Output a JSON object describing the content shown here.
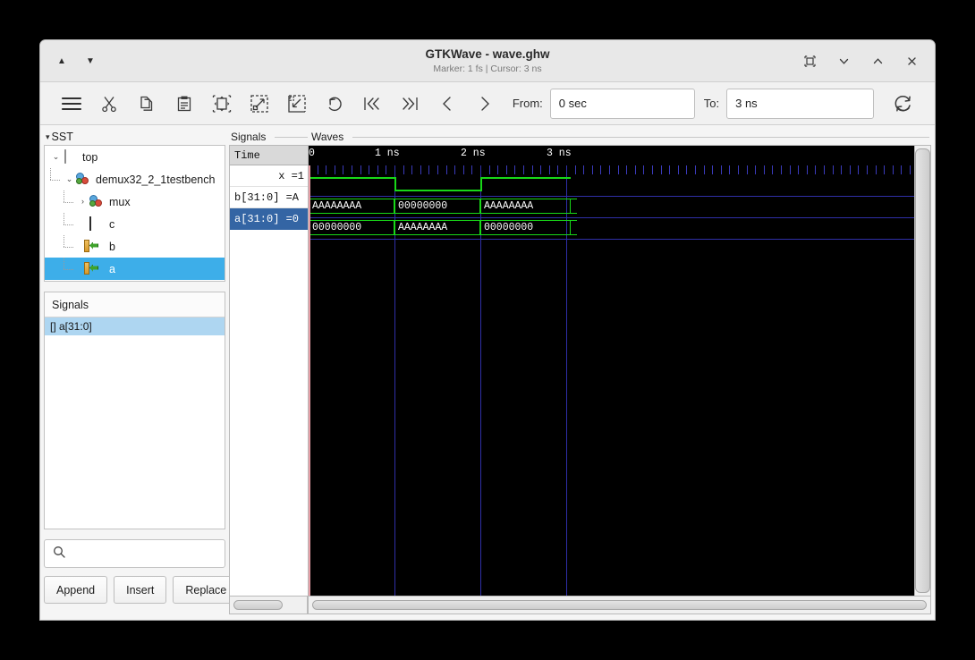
{
  "window": {
    "title": "GTKWave - wave.ghw",
    "subtitle": "Marker: 1 fs  |  Cursor: 3 ns",
    "nav_up": "▲",
    "nav_down": "▼",
    "controls": {
      "restore": "restore-icon",
      "minimize": "minimize-icon",
      "maximize": "maximize-icon",
      "close": "close-icon"
    }
  },
  "toolbar": {
    "icons": [
      "menu-icon",
      "cut-icon",
      "copy-icon",
      "paste-icon",
      "zoom-fit-icon",
      "zoom-in-icon",
      "zoom-out-icon",
      "undo-icon",
      "go-first-icon",
      "go-last-icon",
      "go-previous-icon",
      "go-next-icon"
    ],
    "from_label": "From:",
    "from_value": "0 sec",
    "to_label": "To:",
    "to_value": "3 ns",
    "reload_icon": "reload-icon"
  },
  "sidebar": {
    "sst_label": "SST",
    "tree": [
      {
        "label": "top",
        "icon": "module-top-icon",
        "expander": "⌄",
        "depth": 0
      },
      {
        "label": "demux32_2_1testbench",
        "icon": "module-icon",
        "expander": "⌄",
        "depth": 1
      },
      {
        "label": "mux",
        "icon": "module-icon",
        "expander": "›",
        "depth": 2
      },
      {
        "label": "c",
        "icon": "wave-icon",
        "expander": "",
        "depth": 2
      },
      {
        "label": "b",
        "icon": "port-icon",
        "expander": "",
        "depth": 2
      },
      {
        "label": "a",
        "icon": "port-icon",
        "expander": "",
        "depth": 2,
        "selected": true
      }
    ],
    "signals_header": "Signals",
    "signals": [
      {
        "label": "[] a[31:0]",
        "selected": true
      }
    ],
    "search_placeholder": "",
    "search_value": "",
    "search_icon": "search-icon",
    "buttons": {
      "append": "Append",
      "insert": "Insert",
      "replace": "Replace"
    }
  },
  "waveform": {
    "names_header": "Signals",
    "waves_header": "Waves",
    "time_label": "Time",
    "rows": [
      {
        "name": "x =1",
        "align": "right",
        "selected": false
      },
      {
        "name": "b[31:0] =A",
        "align": "left",
        "selected": false
      },
      {
        "name": "a[31:0] =0",
        "align": "left",
        "selected": true
      }
    ],
    "colors": {
      "background": "#000000",
      "trace": "#18d818",
      "grid": "#2f2fa8",
      "marker": "#e8a0a8",
      "selection": "#3465a4",
      "tree_selection": "#3daee9",
      "list_selection": "#aed6f1"
    }
  },
  "chart_data": {
    "type": "line",
    "title": "GTKWave digital waveform viewer",
    "xlabel": "Time",
    "xlim": [
      0,
      3.45
    ],
    "x_unit": "ns",
    "tick_labels": [
      "0",
      "1 ns",
      "2 ns",
      "3 ns"
    ],
    "tick_positions": [
      0,
      1,
      2,
      3
    ],
    "minor_ticks_per_division": 10,
    "series": [
      {
        "name": "x",
        "kind": "bit",
        "transitions": [
          {
            "t": 0,
            "value": "1"
          },
          {
            "t": 1,
            "value": "0"
          },
          {
            "t": 2,
            "value": "1"
          }
        ],
        "end": 3.05
      },
      {
        "name": "b[31:0]",
        "kind": "bus",
        "transitions": [
          {
            "t": 0,
            "value": "AAAAAAAA"
          },
          {
            "t": 1,
            "value": "00000000"
          },
          {
            "t": 2,
            "value": "AAAAAAAA"
          }
        ],
        "end": 3.05
      },
      {
        "name": "a[31:0]",
        "kind": "bus",
        "transitions": [
          {
            "t": 0,
            "value": "00000000"
          },
          {
            "t": 1,
            "value": "AAAAAAAA"
          },
          {
            "t": 2,
            "value": "00000000"
          }
        ],
        "end": 3.05
      }
    ]
  }
}
